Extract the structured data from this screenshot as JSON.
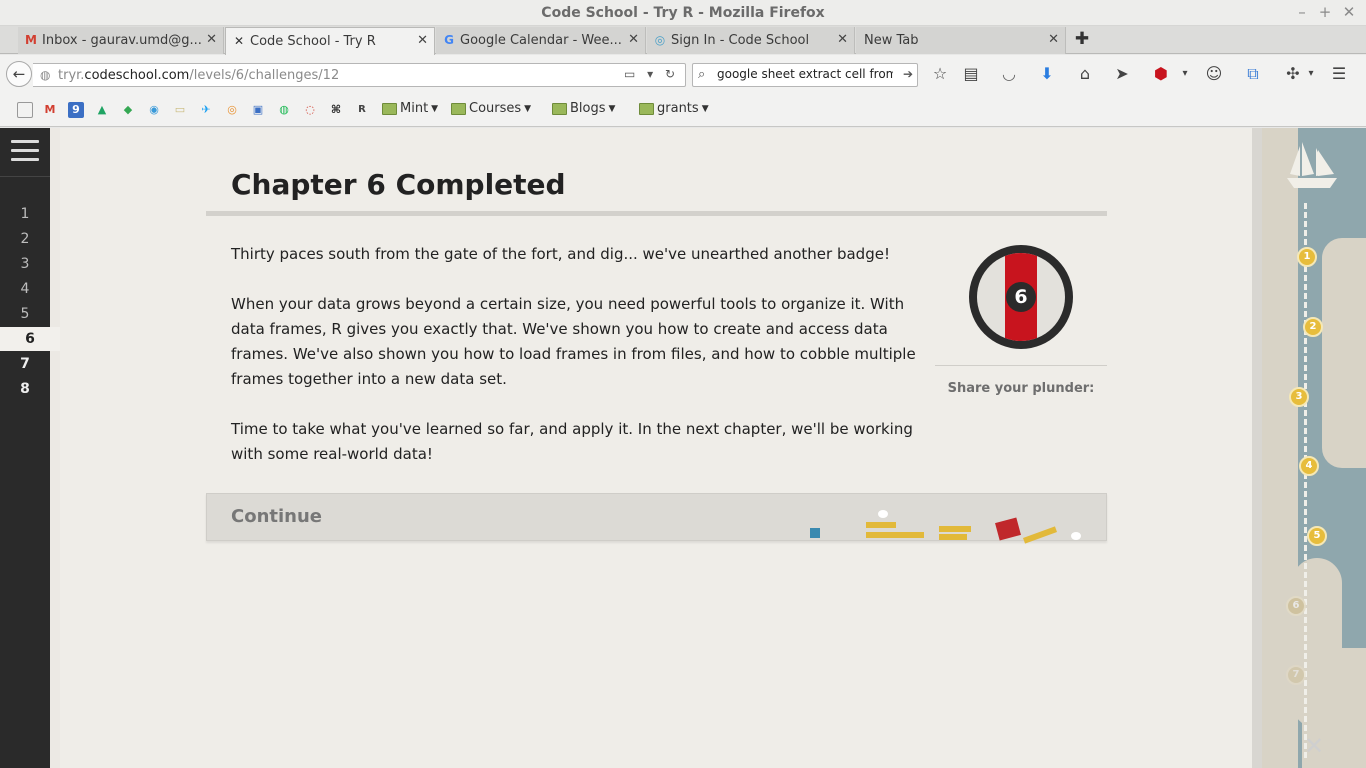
{
  "window": {
    "title": "Code School - Try R - Mozilla Firefox",
    "minimize": "–",
    "maximize": "+",
    "close": "✕"
  },
  "tabs": [
    {
      "label": "Inbox - gaurav.umd@g...",
      "favicon": "M",
      "favicon_color": "#d23f31"
    },
    {
      "label": "Code School - Try R",
      "favicon": "✕",
      "favicon_color": "#333333"
    },
    {
      "label": "Google Calendar - Wee...",
      "favicon": "G",
      "favicon_color": "#4285f4"
    },
    {
      "label": "Sign In - Code School",
      "favicon": "◎",
      "favicon_color": "#4aa0c8"
    },
    {
      "label": "New Tab",
      "favicon": "",
      "favicon_color": "#333333"
    }
  ],
  "tab_close": "✕",
  "newtab_symbol": "✚",
  "nav": {
    "back_symbol": "←",
    "url_prefix": "tryr.",
    "url_domain": "codeschool.com",
    "url_path": "/levels/6/challenges/12",
    "url_controls": "▭ ▾ ↻",
    "search_value": "google sheet extract cell from",
    "search_go": "➔"
  },
  "toolbar_icons": [
    "star-icon",
    "reading-list-icon",
    "pocket-icon",
    "download-icon",
    "home-icon",
    "send-icon",
    "adblock-icon",
    "chat-icon",
    "screenshot-icon",
    "extension-icon",
    "menu-icon"
  ],
  "bookmarks": {
    "icons": [
      "□",
      "M",
      "9",
      "▲",
      "◆",
      "◉",
      "▭",
      "✈",
      "◎",
      "▣",
      "◍",
      "◌",
      "⌘",
      "R"
    ],
    "folders": [
      "Mint",
      "Courses",
      "Blogs",
      "grants"
    ]
  },
  "sidebar": {
    "chapters": [
      "1",
      "2",
      "3",
      "4",
      "5",
      "6",
      "7",
      "8"
    ],
    "current": "6"
  },
  "main": {
    "heading": "Chapter 6 Completed",
    "paragraphs": [
      "Thirty paces south from the gate of the fort, and dig... we've unearthed another badge!",
      "When your data grows beyond a certain size, you need powerful tools to organize it. With data frames, R gives you exactly that. We've shown you how to create and access data frames. We've also shown you how to load frames in from files, and how to cobble multiple frames together into a new data set.",
      "Time to take what you've learned so far, and apply it. In the next chapter, we'll be working with some real-world data!"
    ],
    "badge_number": "6",
    "share_label": "Share your plunder:",
    "continue_label": "Continue"
  },
  "map": {
    "markers": [
      "1",
      "2",
      "3",
      "4",
      "5",
      "6",
      "7"
    ],
    "end_symbol": "✕"
  },
  "colors": {
    "badge_red": "#c8141e",
    "marker_gold": "#e7bd3c",
    "sidebar_bg": "#2a2a2a"
  }
}
